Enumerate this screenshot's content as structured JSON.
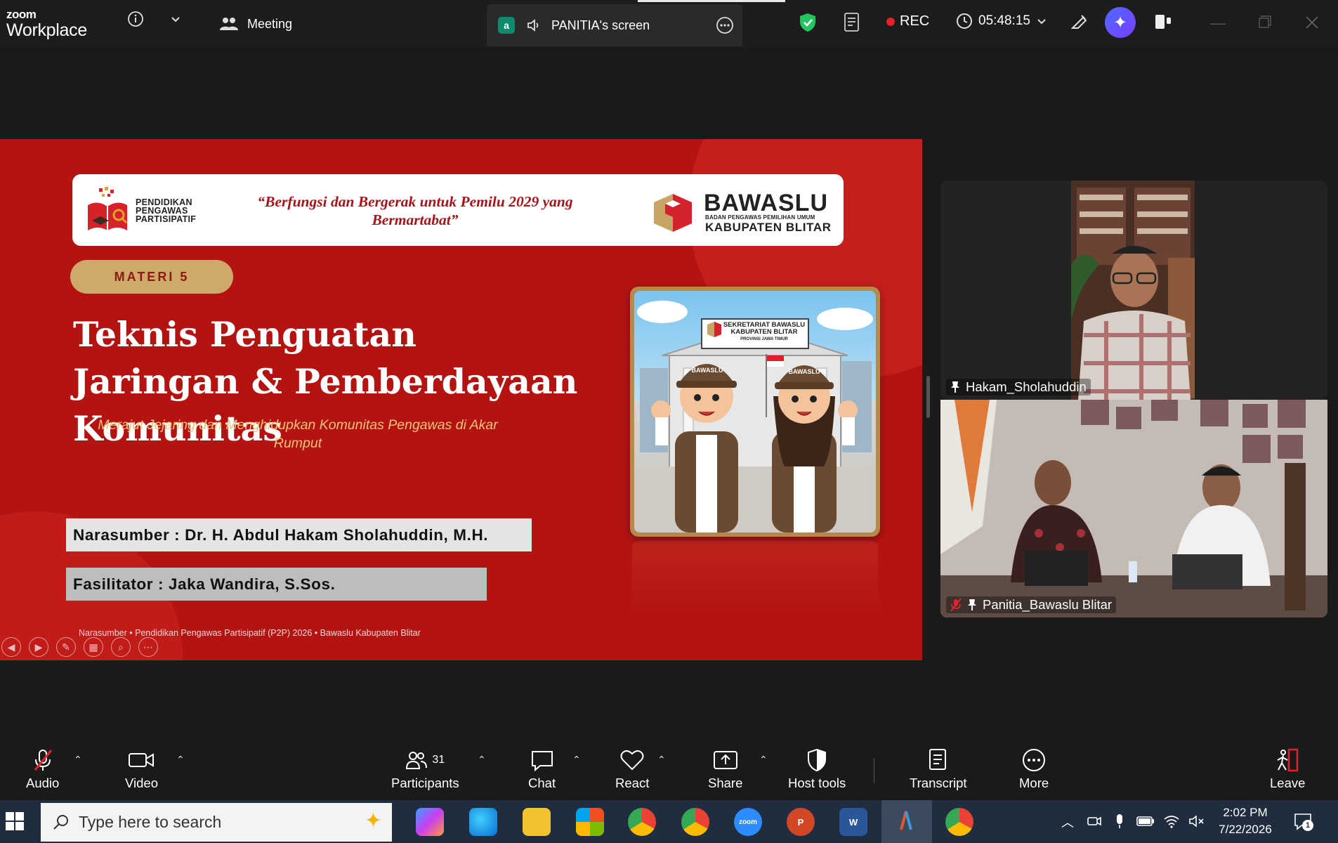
{
  "topbar": {
    "brand_top": "zoom",
    "brand_bottom": "Workplace",
    "meeting_label": "Meeting",
    "share_badge": "a",
    "share_label": "PANITIA's screen",
    "rec_label": "REC",
    "timer": "05:48:15"
  },
  "slide": {
    "logo_text": "PENDIDIKAN\nPENGAWAS\nPARTISIPATIF",
    "quote": "“Berfungsi dan Bergerak untuk Pemilu 2029 yang Bermartabat”",
    "bawaslu_title": "BAWASLU",
    "bawaslu_sub": "BADAN PENGAWAS PEMILIHAN UMUM",
    "bawaslu_kab": "KABUPATEN BLITAR",
    "materi": "MATERI 5",
    "title": "Teknis Penguatan Jaringan & Pemberdayaan Komunitas",
    "subtitle": "Merajut Jejaring dan Menghidupkan Komunitas Pengawas di Akar Rumput",
    "illus_sign": "SEKRETARIAT BAWASLU\nKABUPATEN BLITAR",
    "illus_sign_sub": "PROVINSI JAWA TIMUR",
    "illus_cap": "BAWASLU",
    "narasumber": "Narasumber : Dr. H. Abdul Hakam Sholahuddin, M.H.",
    "fasilitator": "Fasilitator : Jaka Wandira, S.Sos.",
    "footer": "Narasumber  •  Pendidikan Pengawas Partisipatif (P2P) 2026  •  Bawaslu Kabupaten Blitar"
  },
  "videos": [
    {
      "name": "Hakam_Sholahuddin"
    },
    {
      "name": "Panitia_Bawaslu Blitar"
    }
  ],
  "toolbar": {
    "audio": "Audio",
    "video": "Video",
    "participants": "Participants",
    "participants_count": "31",
    "chat": "Chat",
    "react": "React",
    "share": "Share",
    "host_tools": "Host tools",
    "transcript": "Transcript",
    "more": "More",
    "leave": "Leave"
  },
  "taskbar": {
    "search_placeholder": "Type here to search",
    "time": "2:02 PM",
    "date": "7/22/2026",
    "notification_count": "1",
    "zoom_app_label": "zoom"
  },
  "colors": {
    "slide_red": "#b31412",
    "gold": "#cfa96a",
    "rec_red": "#e5222b",
    "shield_green": "#22c55e"
  }
}
